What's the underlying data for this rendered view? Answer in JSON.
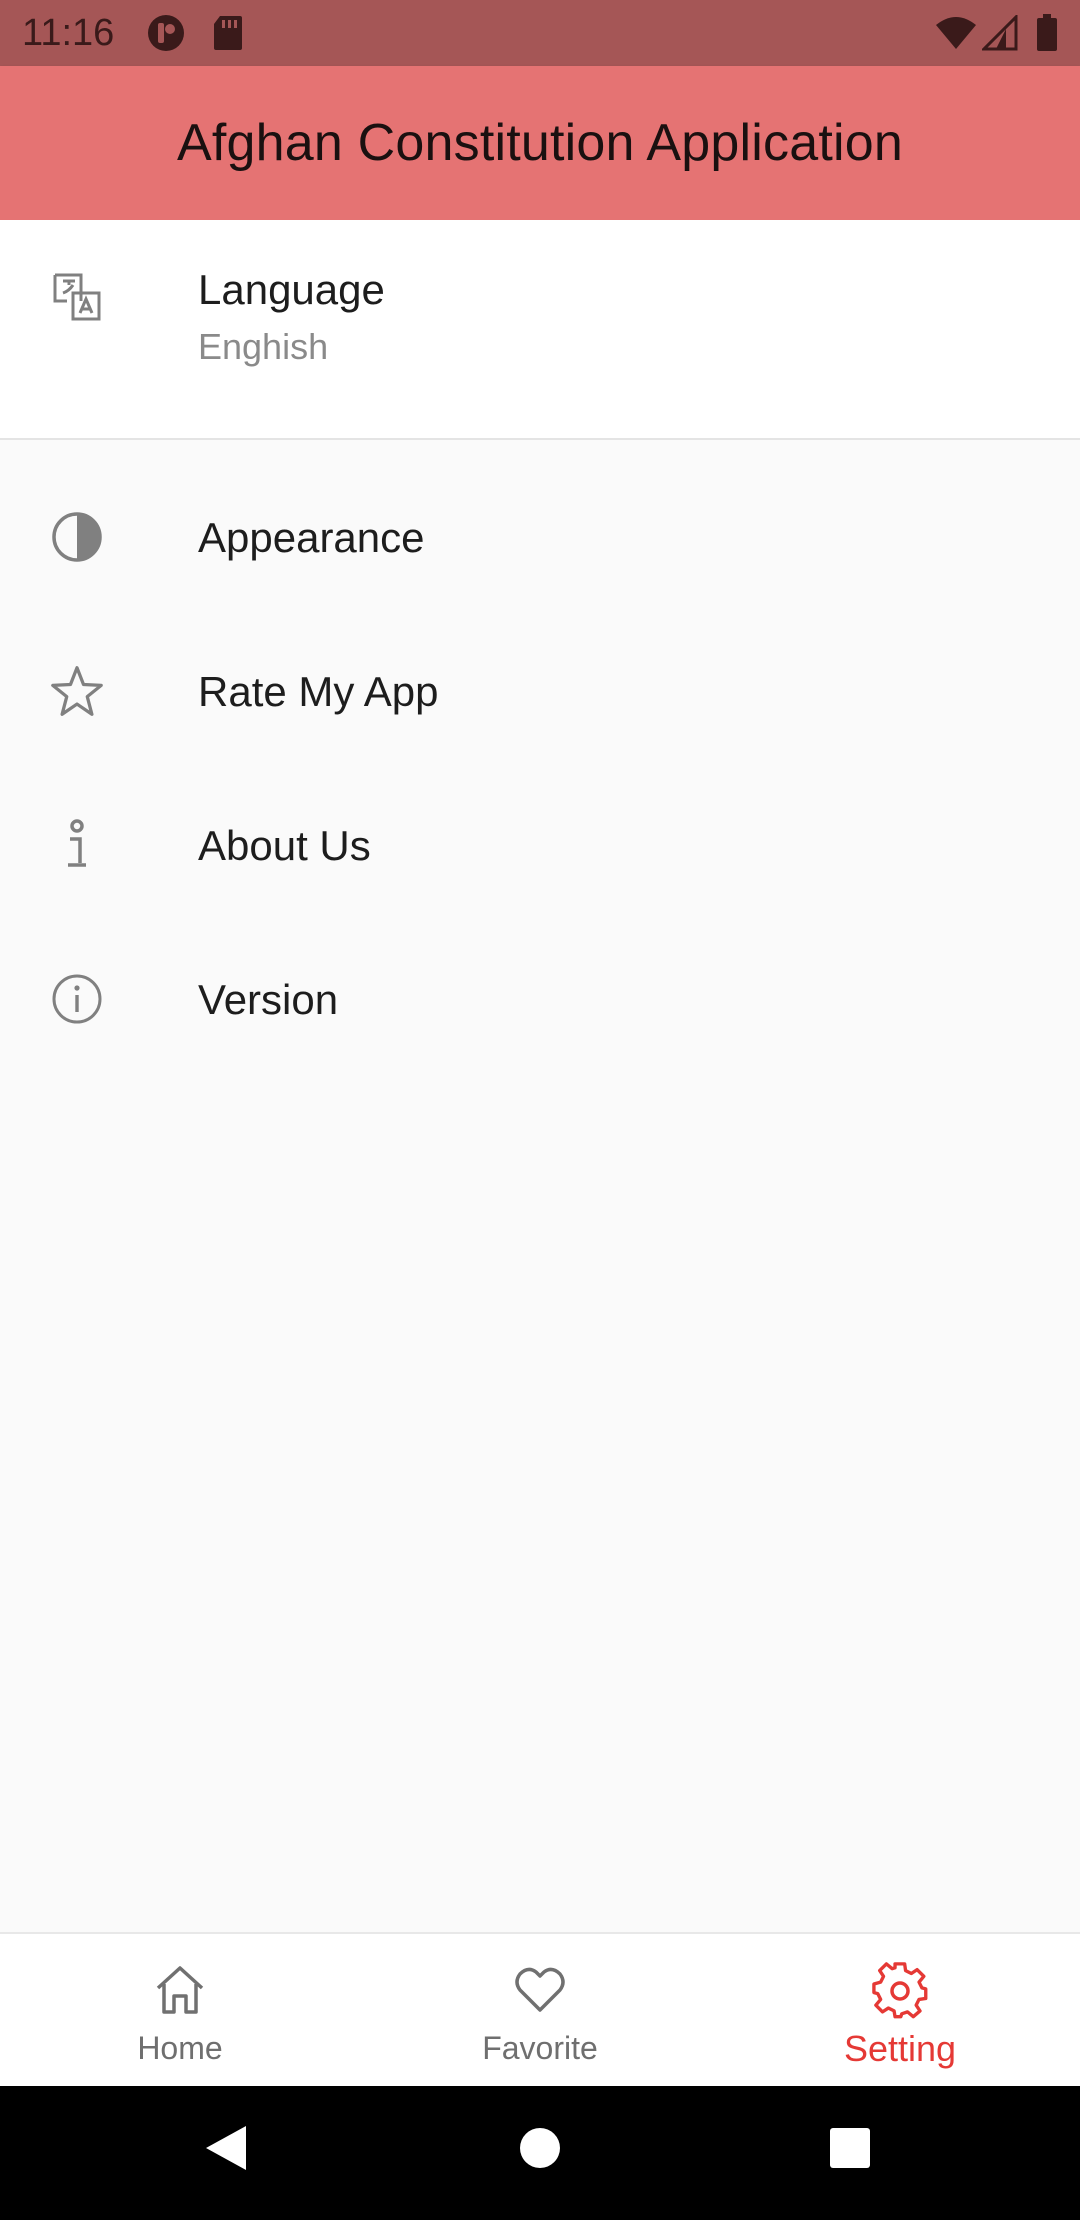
{
  "status_bar": {
    "time": "11:16",
    "icons": [
      "notification-app-icon",
      "sd-card-icon",
      "wifi-icon",
      "signal-icon",
      "battery-icon"
    ]
  },
  "app_bar": {
    "title": "Afghan Constitution Application",
    "color": "#e57373"
  },
  "settings": {
    "language": {
      "title": "Language",
      "value": "Enghish",
      "icon": "translate-icon"
    },
    "items": [
      {
        "label": "Appearance",
        "icon": "contrast-icon"
      },
      {
        "label": "Rate My App",
        "icon": "star-outline-icon"
      },
      {
        "label": "About Us",
        "icon": "info-i-icon"
      },
      {
        "label": "Version",
        "icon": "info-circle-icon"
      }
    ]
  },
  "bottom_nav": {
    "active": "Setting",
    "active_color": "#e53935",
    "items": [
      {
        "label": "Home",
        "icon": "home-icon"
      },
      {
        "label": "Favorite",
        "icon": "heart-icon"
      },
      {
        "label": "Setting",
        "icon": "gear-icon"
      }
    ]
  },
  "system_nav": {
    "buttons": [
      "back-icon",
      "home-circle-icon",
      "recents-square-icon"
    ]
  }
}
